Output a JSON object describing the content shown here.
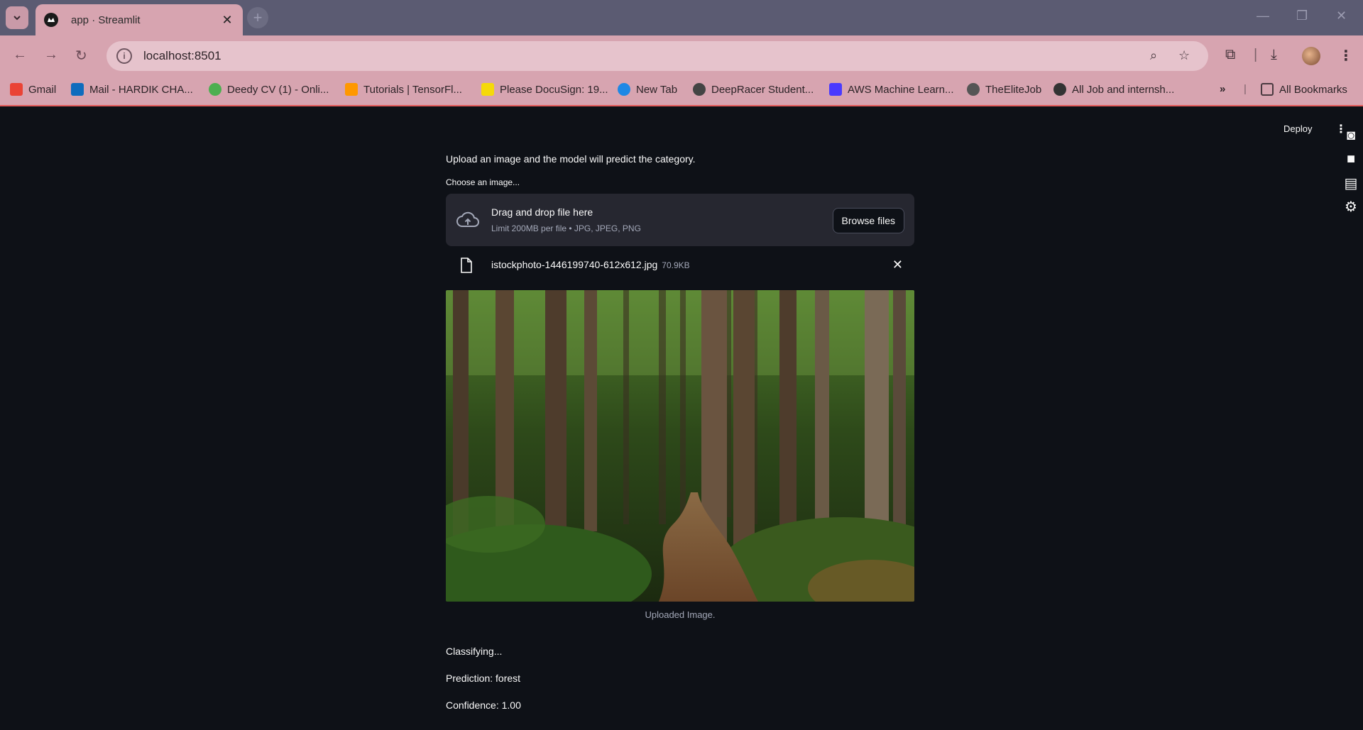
{
  "browser": {
    "tab_title": "app · Streamlit",
    "url": "localhost:8501",
    "bookmarks": [
      {
        "label": "Gmail",
        "color": "#ea4335"
      },
      {
        "label": "Mail - HARDIK CHA...",
        "color": "#0f6cbd"
      },
      {
        "label": "Deedy CV (1) - Onli...",
        "color": "#4caf50"
      },
      {
        "label": "Tutorials  |  TensorFl...",
        "color": "#ff9800"
      },
      {
        "label": "Please DocuSign: 19...",
        "color": "#f5d90a"
      },
      {
        "label": "New Tab",
        "color": "#1e88e5"
      },
      {
        "label": "DeepRacer Student...",
        "color": "#444444"
      },
      {
        "label": "AWS Machine Learn...",
        "color": "#4a3aff"
      },
      {
        "label": "TheEliteJob",
        "color": "#555555"
      },
      {
        "label": "All Job and internsh...",
        "color": "#333333"
      }
    ],
    "all_bookmarks": "All Bookmarks"
  },
  "app": {
    "deploy_label": "Deploy",
    "intro": "Upload an image and the model will predict the category.",
    "uploader_label": "Choose an image...",
    "drop_title": "Drag and drop file here",
    "drop_limits": "Limit 200MB per file • JPG, JPEG, PNG",
    "browse_label": "Browse files",
    "file_name": "istockphoto-1446199740-612x612.jpg",
    "file_size": "70.9KB",
    "image_caption": "Uploaded Image.",
    "status_classifying": "Classifying...",
    "prediction": "Prediction: forest",
    "confidence": "Confidence: 1.00"
  },
  "colors": {
    "app_bg": "#0e1117",
    "dropzone_bg": "#262730",
    "chrome_tint": "#d7a4b0"
  }
}
